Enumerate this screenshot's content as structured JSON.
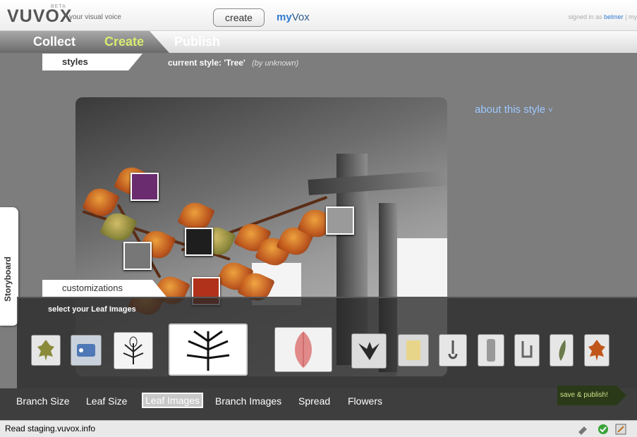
{
  "header": {
    "logo": "VUVOX",
    "beta": "BETA",
    "tagline": "your visual voice",
    "create_label": "create",
    "myvox_prefix": "my",
    "myvox_suffix": "Vox",
    "signed_in_prefix": "signed in as",
    "signed_in_user": "belmer",
    "signed_in_extra": "| my"
  },
  "tabs": [
    {
      "label": "Collect",
      "active": false
    },
    {
      "label": "Create",
      "active": true
    },
    {
      "label": "Publish",
      "active": false
    }
  ],
  "styles": {
    "tab_label": "styles",
    "current_prefix": "current style:",
    "current_name": "'Tree'",
    "current_author": "(by unknown)",
    "about_label": "about this style"
  },
  "storyboard": {
    "label": "Storyboard"
  },
  "customizations": {
    "tab_label": "customizations",
    "select_label": "select your Leaf Images",
    "options": [
      {
        "name": "oak-leaf-green"
      },
      {
        "name": "blue-tag"
      },
      {
        "name": "sketch-leaves"
      },
      {
        "name": "fern-leaf-sketch",
        "selected": true
      },
      {
        "name": "red-leaf"
      },
      {
        "name": "dark-leaf"
      },
      {
        "name": "yellow-ticket"
      },
      {
        "name": "metal-clip"
      },
      {
        "name": "usb-drive"
      },
      {
        "name": "metal-hooks"
      },
      {
        "name": "green-leaf-blade"
      },
      {
        "name": "autumn-oak-leaf"
      }
    ]
  },
  "bottom_nav": [
    {
      "label": "Branch Size",
      "active": false
    },
    {
      "label": "Leaf Size",
      "active": false
    },
    {
      "label": "Leaf Images",
      "active": true
    },
    {
      "label": "Branch Images",
      "active": false
    },
    {
      "label": "Spread",
      "active": false
    },
    {
      "label": "Flowers",
      "active": false
    }
  ],
  "save_publish_label": "save & publish!",
  "status_bar": {
    "text": "Read staging.vuvox.info"
  },
  "colors": {
    "accent_green": "#d8ec70",
    "link_blue": "#2f7ad0",
    "about_blue": "#9cc8ff"
  }
}
